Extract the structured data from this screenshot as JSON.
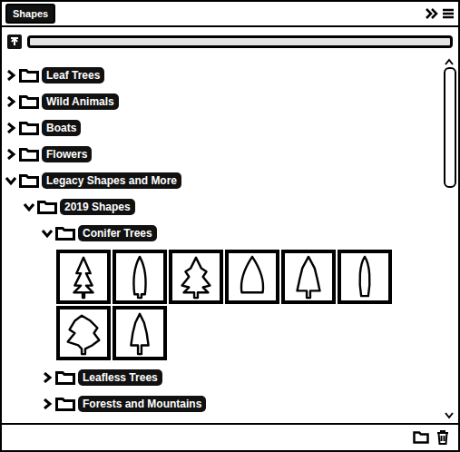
{
  "panel": {
    "tab": {
      "label": "Shapes",
      "selected": true
    }
  },
  "search": {
    "value": ""
  },
  "tree": [
    {
      "label": "Leaf Trees",
      "depth": 0,
      "expanded": false,
      "kind": "folder"
    },
    {
      "label": "Wild Animals",
      "depth": 0,
      "expanded": false,
      "kind": "folder"
    },
    {
      "label": "Boats",
      "depth": 0,
      "expanded": false,
      "kind": "folder"
    },
    {
      "label": "Flowers",
      "depth": 0,
      "expanded": false,
      "kind": "folder"
    },
    {
      "label": "Legacy Shapes and More",
      "depth": 0,
      "expanded": true,
      "kind": "folder"
    },
    {
      "label": "2019 Shapes",
      "depth": 1,
      "expanded": true,
      "kind": "folder"
    },
    {
      "label": "Conifer Trees",
      "depth": 2,
      "expanded": true,
      "kind": "folder"
    },
    {
      "kind": "shapes",
      "depth": 2,
      "shapes": [
        {
          "selected": false
        },
        {
          "selected": false
        },
        {
          "selected": false
        },
        {
          "selected": false
        },
        {
          "selected": false
        },
        {
          "selected": false
        },
        {
          "selected": false
        },
        {
          "selected": false
        }
      ]
    },
    {
      "label": "Leafless Trees",
      "depth": 2,
      "expanded": false,
      "kind": "folder"
    },
    {
      "label": "Forests and Mountains",
      "depth": 2,
      "expanded": false,
      "kind": "folder"
    }
  ],
  "scrollbar": {
    "level": 0.34
  }
}
